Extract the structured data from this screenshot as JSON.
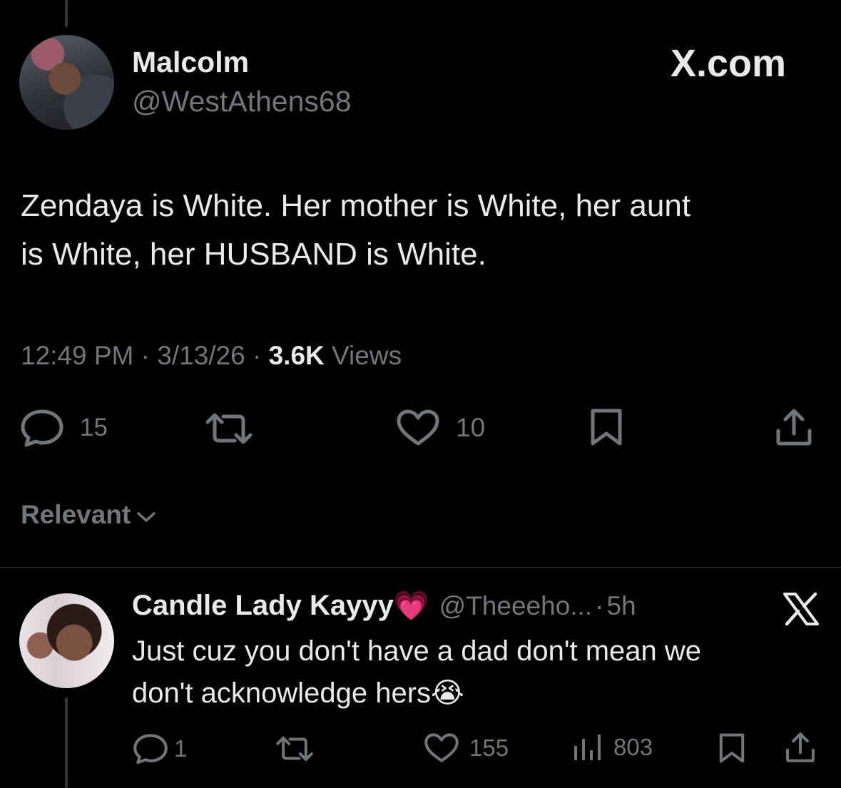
{
  "main_tweet": {
    "author_name": "Malcolm",
    "author_handle": "@WestAthens68",
    "brand": "X.com",
    "text_line1": "Zendaya is White. Her mother is White, her aunt",
    "text_line2": "is White, her HUSBAND is White.",
    "time": "12:49 PM",
    "date": "3/13/26",
    "views_count": "3.6K",
    "views_label": "Views",
    "separator": "·",
    "reply_count": "15",
    "like_count": "10"
  },
  "sort": {
    "label": "Relevant"
  },
  "reply": {
    "author_name": "Candle Lady Kayyy",
    "emoji": "💗",
    "author_handle": "@Theeeho...",
    "time_ago": "5h",
    "separator": "·",
    "text_line1": "Just cuz you don't have a dad don't mean we",
    "text_line2": "don't acknowledge hers",
    "trailing_emoji": "😭",
    "reply_count": "1",
    "like_count": "155",
    "view_count": "803"
  },
  "colors": {
    "background": "#000000",
    "primary_text": "#e7e9ea",
    "secondary_text": "#71767b",
    "divider": "#2f3336"
  }
}
